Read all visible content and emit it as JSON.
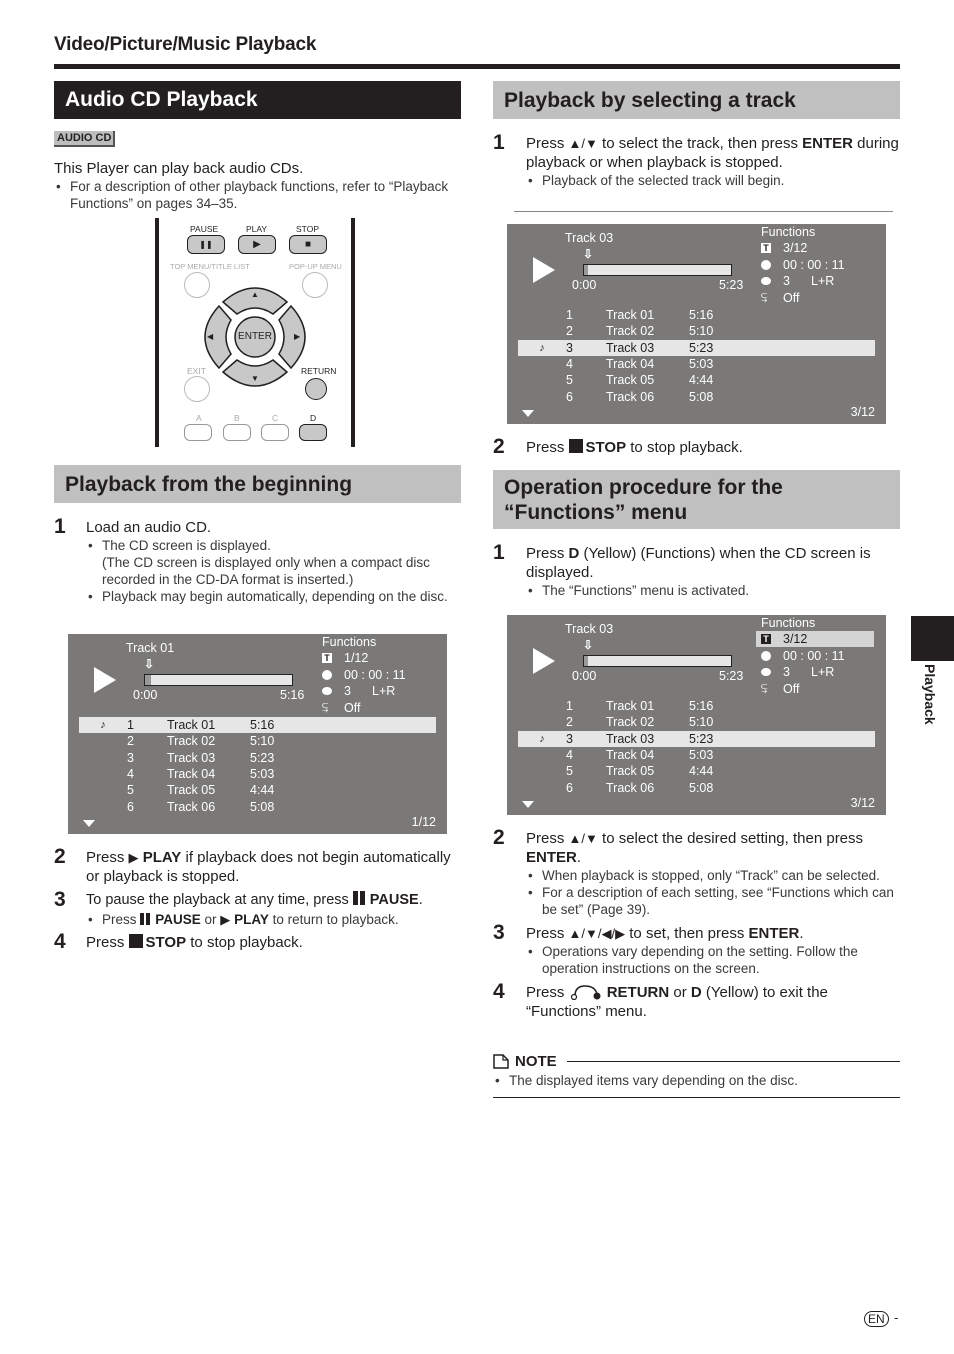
{
  "header": {
    "title": "Video/Picture/Music Playback"
  },
  "audio_cd": {
    "title": "Audio CD Playback",
    "badge": "AUDIO CD",
    "intro": "This Player can play back audio CDs.",
    "bullet": "For a description of other playback functions, refer to “Playback Functions” on pages 34–35."
  },
  "remote": {
    "pause": "PAUSE",
    "play": "PLAY",
    "stop": "STOP",
    "top_menu": "TOP MENU/TITLE LIST",
    "popup_menu": "POP-UP MENU",
    "enter": "ENTER",
    "exit": "EXIT",
    "return": "RETURN",
    "a": "A",
    "b": "B",
    "c": "C",
    "d": "D",
    "pause_glyph": "❚❚",
    "play_glyph": "▶",
    "stop_glyph": "■",
    "up_glyph": "▲",
    "down_glyph": "▼",
    "left_glyph": "◀",
    "right_glyph": "▶"
  },
  "from_beginning": {
    "title": "Playback from the beginning",
    "steps": [
      {
        "num": "1",
        "text": "Load an audio CD.",
        "bullets": [
          "The CD screen is displayed.\n(The CD screen is displayed only when a compact disc recorded in the CD-DA format is inserted.)",
          "Playback may begin automatically, depending on the disc."
        ]
      },
      {
        "num": "2",
        "pre": "Press ",
        "glyph": "▶",
        "bold": "PLAY",
        "post": " if playback does not begin automatically or playback is stopped."
      },
      {
        "num": "3",
        "pre": "To pause the playback at any time, press ",
        "bold": "PAUSE",
        "post": ".",
        "bullet_pre": "Press ",
        "bullet_bold1": "PAUSE",
        "bullet_mid": " or ",
        "bullet_glyph": "▶",
        "bullet_bold2": "PLAY",
        "bullet_post": " to return to playback."
      },
      {
        "num": "4",
        "pre": "Press ",
        "bold": "STOP",
        "post": " to stop playback."
      }
    ]
  },
  "screens": [
    {
      "track_title": "Track 01",
      "start": "0:00",
      "end": "5:16",
      "progress": 0.04,
      "functions_label": "Functions",
      "functions": {
        "track": "1/12",
        "time": "00 : 00 : 11",
        "audio_num": "3",
        "audio_ch": "L+R",
        "repeat": "Off"
      },
      "functions_selected": false,
      "selected_track": 0,
      "page": "1/12"
    },
    {
      "track_title": "Track 03",
      "start": "0:00",
      "end": "5:23",
      "progress": 0.03,
      "functions_label": "Functions",
      "functions": {
        "track": "3/12",
        "time": "00 : 00 : 11",
        "audio_num": "3",
        "audio_ch": "L+R",
        "repeat": "Off"
      },
      "functions_selected": false,
      "selected_track": 2,
      "page": "3/12"
    },
    {
      "track_title": "Track 03",
      "start": "0:00",
      "end": "5:23",
      "progress": 0.03,
      "functions_label": "Functions",
      "functions": {
        "track": "3/12",
        "time": "00 : 00 : 11",
        "audio_num": "3",
        "audio_ch": "L+R",
        "repeat": "Off"
      },
      "functions_selected": true,
      "selected_track": 2,
      "page": "3/12"
    }
  ],
  "tracks": [
    {
      "num": "1",
      "name": "Track 01",
      "duration": "5:16"
    },
    {
      "num": "2",
      "name": "Track 02",
      "duration": "5:10"
    },
    {
      "num": "3",
      "name": "Track 03",
      "duration": "5:23"
    },
    {
      "num": "4",
      "name": "Track 04",
      "duration": "5:03"
    },
    {
      "num": "5",
      "name": "Track 05",
      "duration": "4:44"
    },
    {
      "num": "6",
      "name": "Track 06",
      "duration": "5:08"
    }
  ],
  "selecting_track": {
    "title": "Playback by selecting a track",
    "step1_pre": "Press ",
    "step1_glyph": "▲/▼",
    "step1_mid": " to select the track, then press ",
    "step1_bold": "ENTER",
    "step1_post": " during playback or when playback is stopped.",
    "step1_bullet": "Playback of the selected track will begin.",
    "step2_pre": "Press ",
    "step2_bold": "STOP",
    "step2_post": " to stop playback."
  },
  "functions_menu": {
    "title_line1": "Operation procedure for the",
    "title_line2": "“Functions” menu",
    "step1_pre": "Press ",
    "step1_bold": "D",
    "step1_post": " (Yellow) (Functions) when the CD screen is displayed.",
    "step1_bullet": "The “Functions” menu is activated.",
    "step2_pre": "Press ",
    "step2_glyph": "▲/▼",
    "step2_mid": " to select the desired setting, then press ",
    "step2_bold": "ENTER",
    "step2_post": ".",
    "step2_bullets": [
      "When playback is stopped, only “Track” can be selected.",
      "For a description of each setting, see “Functions which can be set” (Page 39)."
    ],
    "step3_pre": "Press ",
    "step3_glyph": "▲/▼/◀/▶",
    "step3_mid": " to set, then press ",
    "step3_bold": "ENTER",
    "step3_post": ".",
    "step3_bullet": "Operations vary depending on the setting. Follow the operation instructions on the screen.",
    "step4_pre": "Press ",
    "step4_bold1": "RETURN",
    "step4_mid": " or ",
    "step4_bold2": "D",
    "step4_post": " (Yellow) to exit the “Functions” menu."
  },
  "note": {
    "label": "NOTE",
    "text": "The displayed items vary depending on the disc."
  },
  "side_tab": {
    "label": "Playback"
  },
  "footer": {
    "lang": "EN",
    "page_suffix": "-"
  }
}
